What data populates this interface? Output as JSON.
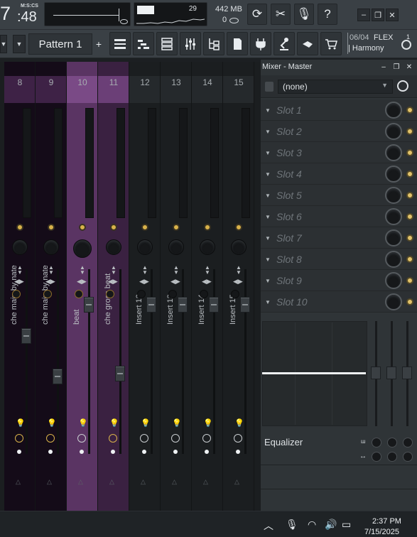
{
  "time": {
    "big": "7",
    "label": "M:S:CS",
    "small": ":48"
  },
  "cpu": {
    "value": "29"
  },
  "memory": {
    "value": "442 MB",
    "polyphony": "0"
  },
  "pattern": {
    "name": "Pattern 1"
  },
  "news": {
    "date": "06/04",
    "title": "FLEX",
    "subtitle": "| Harmony",
    "count": "1"
  },
  "mixer": {
    "columns": [
      {
        "number": "8",
        "name": "che main by nate"
      },
      {
        "number": "9",
        "name": "che main by nate"
      },
      {
        "number": "10",
        "name": "beat"
      },
      {
        "number": "11",
        "name": "che gross beat"
      },
      {
        "number": "12",
        "name": "Insert 12"
      },
      {
        "number": "13",
        "name": "Insert 13"
      },
      {
        "number": "14",
        "name": "Insert 14"
      },
      {
        "number": "15",
        "name": "Insert 15"
      }
    ]
  },
  "master": {
    "title": "Mixer - Master",
    "input": "(none)",
    "slots": [
      "Slot 1",
      "Slot 2",
      "Slot 3",
      "Slot 4",
      "Slot 5",
      "Slot 6",
      "Slot 7",
      "Slot 8",
      "Slot 9",
      "Slot 10"
    ],
    "eq_label": "Equalizer"
  },
  "taskbar": {
    "time": "2:37 PM",
    "date": "7/15/2025"
  },
  "colors": {
    "purple_dark": "#1a0f1f",
    "purple_mid": "#3b2242",
    "purple_light": "#5b3565",
    "accent": "#d8b24a"
  }
}
